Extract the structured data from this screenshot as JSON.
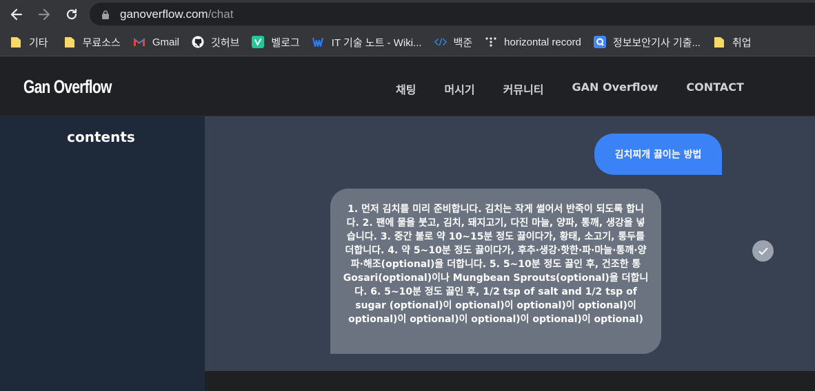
{
  "browser": {
    "url_host": "ganoverflow.com",
    "url_path": "/chat",
    "bookmarks": [
      {
        "label": "기타",
        "icon": "folder-icon"
      },
      {
        "label": "무료소스",
        "icon": "folder-icon"
      },
      {
        "label": "Gmail",
        "icon": "gmail-icon"
      },
      {
        "label": "깃허브",
        "icon": "github-icon"
      },
      {
        "label": "벨로그",
        "icon": "velog-icon"
      },
      {
        "label": "IT 기술 노트 - Wiki...",
        "icon": "wiki-icon"
      },
      {
        "label": "백준",
        "icon": "code-icon"
      },
      {
        "label": "horizontal record",
        "icon": "dots-icon"
      },
      {
        "label": "정보보안기사 기출...",
        "icon": "quizlet-icon"
      },
      {
        "label": "취업",
        "icon": "folder-icon"
      }
    ]
  },
  "header": {
    "logo": "Gan Overflow",
    "nav": [
      "채팅",
      "머시기",
      "커뮤니티",
      "GAN Overflow",
      "CONTACT"
    ]
  },
  "sidebar": {
    "title": "contents"
  },
  "chat": {
    "user_message": "김치찌개 끓이는 방법",
    "bot_message": "1. 먼저 김치를 미리 준비합니다. 김치는 작게 썰어서 반죽이 되도록 합니다. 2. 팬에 물을 붓고, 김치, 돼지고기, 다진 마늘, 양파, 통깨, 생강을 넣습니다. 3. 중간 불로 약 10~15분 정도 끓이다가, 황태, 소고기, 통두를 더합니다. 4. 약 5~10분 정도 끓이다가, 후추·생강·핫한·파·마늘·통깨·양파·해조(optional)을 더합니다. 5. 5~10분 정도 끓인 후, 건조한 통Gosari(optional)이나 Mungbean Sprouts(optional)을 더합니다. 6. 5~10분 정도 끓인 후, 1/2 tsp of salt and 1/2 tsp of sugar (optional)이 optional)이 optional)이 optional)이 optional)이 optional)이 optional)이 optional)이 optional)"
  },
  "colors": {
    "user_bubble": "#3b82f6",
    "bot_bubble": "#6b7280",
    "sidebar_bg": "#1e2939",
    "main_bg": "#374152"
  }
}
